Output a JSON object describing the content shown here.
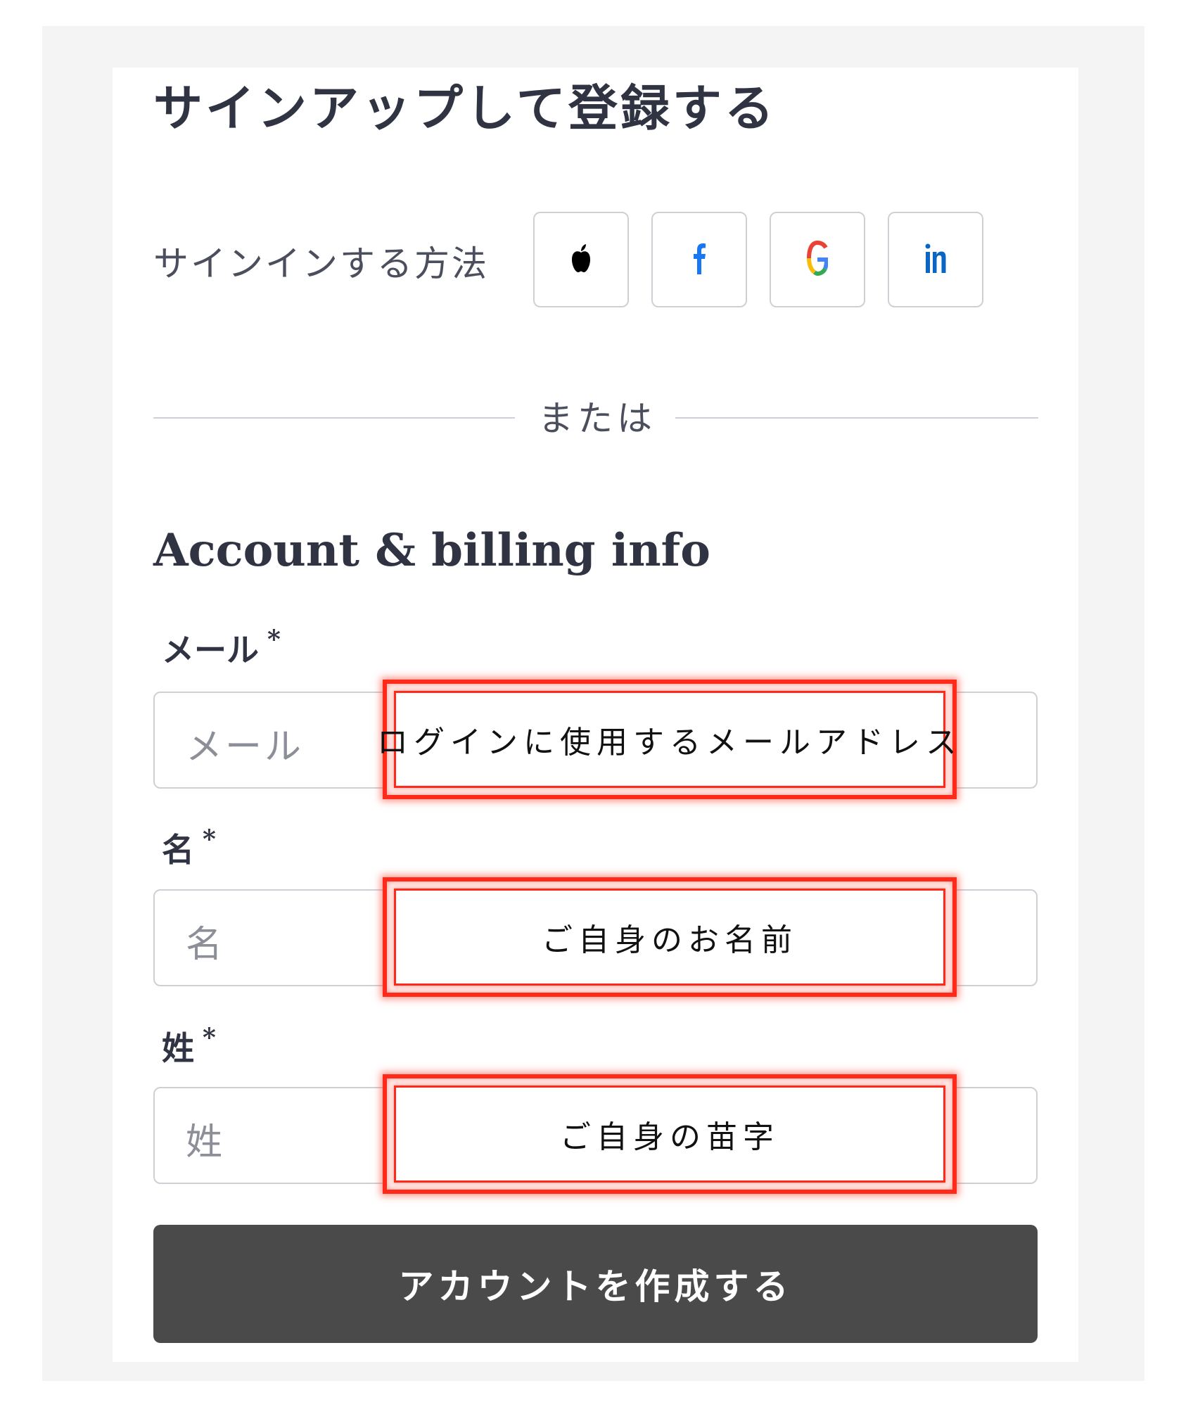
{
  "header": {
    "title": "サインアップして登録する"
  },
  "social": {
    "label": "サインインする方法",
    "providers": [
      {
        "name": "Apple",
        "icon": "apple-icon",
        "color": "#000000"
      },
      {
        "name": "Facebook",
        "icon": "facebook-icon",
        "color": "#1877f2"
      },
      {
        "name": "Google",
        "icon": "google-icon",
        "color": "#4285f4"
      },
      {
        "name": "LinkedIn",
        "icon": "linkedin-icon",
        "color": "#0a66c2"
      }
    ]
  },
  "divider": {
    "text": "または"
  },
  "form": {
    "section_title": "Account & billing info",
    "required_mark": "*",
    "fields": [
      {
        "label": "メール",
        "placeholder": "メール",
        "callout": "ログインに使用するメールアドレス"
      },
      {
        "label": "名",
        "placeholder": "名",
        "callout": "ご自身のお名前"
      },
      {
        "label": "姓",
        "placeholder": "姓",
        "callout": "ご自身の苗字"
      }
    ],
    "submit_label": "アカウントを作成する"
  },
  "colors": {
    "callout_border": "#ff2a1a",
    "submit_bg": "#4a4a4a",
    "heading": "#2f3342"
  }
}
